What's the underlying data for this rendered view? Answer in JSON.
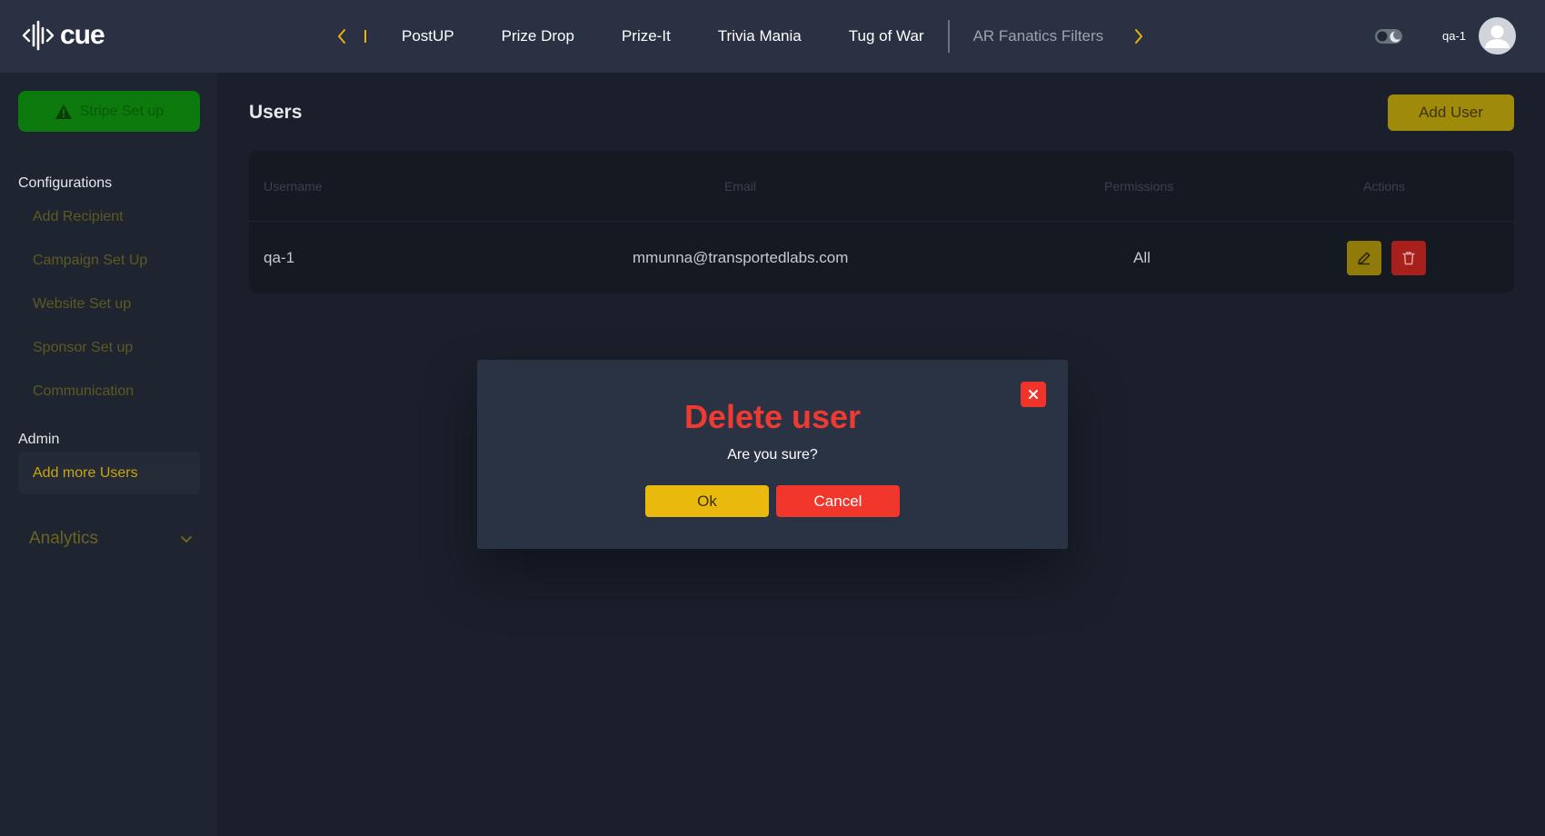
{
  "brand": {
    "name": "cue"
  },
  "nav": {
    "tabs": [
      {
        "label": "PostUP"
      },
      {
        "label": "Prize Drop"
      },
      {
        "label": "Prize-It"
      },
      {
        "label": "Trivia Mania"
      },
      {
        "label": "Tug of War"
      }
    ],
    "secondary_tab": "AR Fanatics Filters",
    "prev_icon": "chevron-left-icon",
    "next_icon": "chevron-right-icon"
  },
  "user": {
    "name": "qa-1",
    "avatar_icon": "user-avatar-icon"
  },
  "sidebar": {
    "stripe_button": "Stripe Set up",
    "configurations_heading": "Configurations",
    "config_items": [
      {
        "label": "Add Recipient"
      },
      {
        "label": "Campaign Set Up"
      },
      {
        "label": "Website Set up"
      },
      {
        "label": "Sponsor Set up"
      },
      {
        "label": "Communication"
      }
    ],
    "admin_heading": "Admin",
    "admin_items": [
      {
        "label": "Add more Users"
      }
    ],
    "analytics_label": "Analytics"
  },
  "main": {
    "title": "Users",
    "add_user_button": "Add User",
    "table": {
      "headers": [
        "Username",
        "Email",
        "Permissions",
        "Actions"
      ],
      "rows": [
        {
          "username": "qa-1",
          "email": "mmunna@transportedlabs.com",
          "permissions": "All"
        }
      ]
    }
  },
  "modal": {
    "title": "Delete user",
    "message": "Are you sure?",
    "ok_label": "Ok",
    "cancel_label": "Cancel"
  },
  "colors": {
    "accent_yellow": "#eab308",
    "danger_red": "#f0342a",
    "topbar": "#293142",
    "background": "#1a1f2b"
  }
}
